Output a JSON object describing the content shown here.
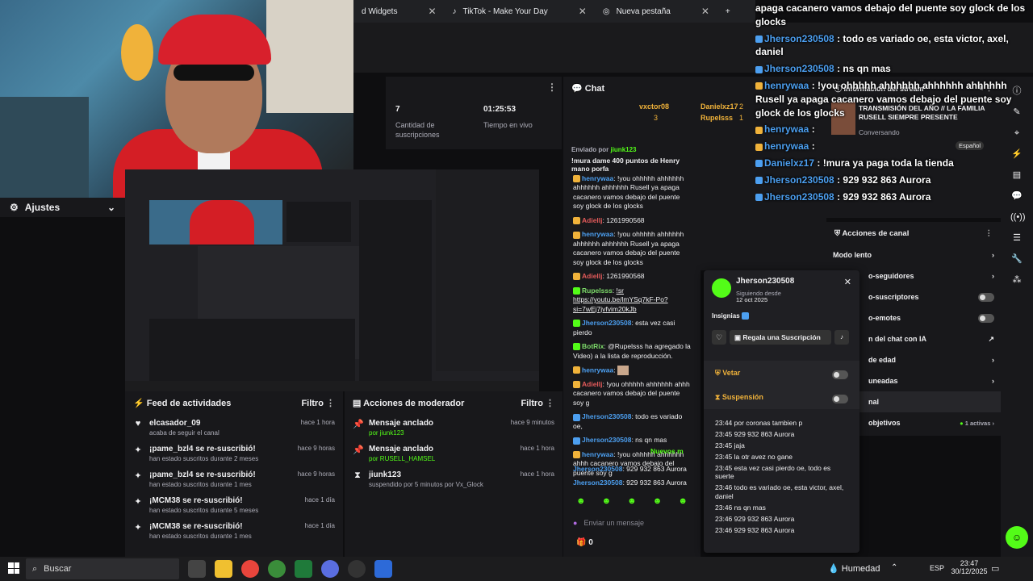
{
  "browser": {
    "tabs": [
      {
        "label": "d Widgets"
      },
      {
        "label": "TikTok - Make Your Day"
      },
      {
        "label": "Nueva pestaña"
      }
    ]
  },
  "settings": {
    "label": "Ajustes"
  },
  "stats": {
    "subs_value": "7",
    "subs_label": "Cantidad de suscripciones",
    "time_value": "01:25:53",
    "time_label": "Tiempo en vivo"
  },
  "feed": {
    "title": "Feed de actividades",
    "filter": "Filtro",
    "items": [
      {
        "title": "elcasador_09",
        "sub": "acaba de seguir el canal",
        "when": "hace 1 hora"
      },
      {
        "title": "¡pame_bzl4 se re-suscribió!",
        "sub": "han estado suscritos durante 2 meses",
        "when": "hace 9 horas"
      },
      {
        "title": "¡pame_bzl4 se re-suscribió!",
        "sub": "han estado suscritos durante 1 mes",
        "when": "hace 9 horas"
      },
      {
        "title": "¡MCM38 se re-suscribió!",
        "sub": "han estado suscritos durante 5 meses",
        "when": "hace 1 día"
      },
      {
        "title": "¡MCM38 se re-suscribió!",
        "sub": "han estado suscritos durante 1 mes",
        "when": "hace 1 día"
      }
    ]
  },
  "modactions": {
    "title": "Acciones de moderador",
    "filter": "Filtro",
    "items": [
      {
        "title": "Mensaje anclado",
        "sub": "por jiunk123",
        "when": "hace 9 minutos"
      },
      {
        "title": "Mensaje anclado",
        "sub": "por RUSELL_HAMSEL",
        "when": "hace 1 hora"
      },
      {
        "title": "jiunk123",
        "sub": "suspendido por 5 minutos por Vx_Glock",
        "when": "hace 1 hora"
      }
    ]
  },
  "chat": {
    "title": "Chat",
    "top_users": [
      "vxctor08",
      "Danielxz17",
      "Rupelsss"
    ],
    "top_counts": [
      "3",
      "2",
      "1"
    ],
    "pinned_by": "Enviado por",
    "pinned_user": "jiunk123",
    "pinned_msg": "!mura dame 400 puntos de Henry mano porfa",
    "lines": [
      {
        "user": "henrywaa",
        "color": "#4c9ff0",
        "text": "!you ohhhhh ahhhhhh ahhhhhh ahhhhhh Rusell ya apaga cacanero vamos debajo del puente soy glock de los glocks"
      },
      {
        "user": "Adiellj",
        "color": "#e25a5a",
        "text": "1261990568"
      },
      {
        "user": "henrywaa",
        "color": "#4c9ff0",
        "text": "!you ohhhhh ahhhhhh ahhhhhh ahhhhhh Rusell ya apaga cacanero vamos debajo del puente soy glock de los glocks"
      },
      {
        "user": "Adiellj",
        "color": "#e25a5a",
        "text": "1261990568"
      },
      {
        "user": "Rupelsss",
        "color": "#7ddb6a",
        "text": "!sr https://youtu.be/lmYSq7kF-Po?si=7wEj7jvfvim20kJb"
      },
      {
        "user": "Jherson230508",
        "color": "#4c9ff0",
        "text": "esta vez casi pierdo"
      },
      {
        "user": "BotRix",
        "color": "#7ddb6a",
        "text": "@Rupelsss ha agregado la Video) a la lista de reproducción."
      },
      {
        "user": "henrywaa",
        "color": "#4c9ff0",
        "text": ""
      },
      {
        "user": "Adiellj",
        "color": "#e25a5a",
        "text": "!you ohhhhh ahhhhhh ahhh cacanero vamos debajo del puente soy g"
      },
      {
        "user": "Jherson230508",
        "color": "#4c9ff0",
        "text": "todo es variado oe,"
      },
      {
        "user": "Jherson230508",
        "color": "#4c9ff0",
        "text": "ns qn mas"
      },
      {
        "user": "henrywaa",
        "color": "#4c9ff0",
        "text": "!you ohhhhh ahhhhhh ahhh cacanero vamos debajo del puente soy g"
      },
      {
        "user": "henrywaa",
        "color": "#4c9ff0",
        "text": ""
      },
      {
        "user": "henrywaa",
        "color": "#4c9ff0",
        "text": ""
      },
      {
        "user": "Danielxz17",
        "color": "#4c9ff0",
        "text": "!mura ya paga toda la"
      }
    ],
    "new_msgs": "Nuevos m",
    "after": [
      {
        "user": "Jherson230508",
        "color": "#4c9ff0",
        "text": "929 932 863 Aurora"
      },
      {
        "user": "Jherson230508",
        "color": "#4c9ff0",
        "text": "929 932 863 Aurora"
      }
    ],
    "input_placeholder": "Enviar un mensaje",
    "points": "0"
  },
  "usercard": {
    "name": "Jherson230508",
    "following_label": "Siguiendo desde",
    "following_date": "12 oct 2025",
    "badges_label": "Insignias",
    "gift_label": "Regala una Suscripción",
    "veto_label": "Vetar",
    "suspend_label": "Suspensión",
    "history": [
      "23:44 por coronas tambien p",
      "23:45 929 932 863 Aurora",
      "23:45 jaja",
      "23:45 la otr avez no gane",
      "23:45 esta vez casi pierdo oe, todo es suerte",
      "23:46 todo es variado oe, esta victor, axel, daniel",
      "23:46 ns qn mas",
      "23:46 929 932 863 Aurora",
      "23:46 929 932 863 Aurora"
    ]
  },
  "overlay": {
    "lines": [
      {
        "user": "",
        "text": "apaga cacanero vamos debajo del puente soy glock de los glocks"
      },
      {
        "user": "Jherson230508",
        "text": ": todo es variado oe, esta victor, axel, daniel"
      },
      {
        "user": "Jherson230508",
        "text": ": ns qn mas"
      },
      {
        "user": "henrywaa",
        "text": ": !you ohhhhh ahhhhhh ahhhhhh ahhhhhh Rusell ya apaga cacanero vamos debajo del puente soy glock de los glocks"
      },
      {
        "user": "henrywaa",
        "text": ":"
      },
      {
        "user": "henrywaa",
        "text": ":"
      },
      {
        "user": "Danielxz17",
        "text": ": !mura ya paga toda la tienda"
      },
      {
        "user": "Jherson230508",
        "text": ": 929 932 863 Aurora"
      },
      {
        "user": "Jherson230508",
        "text": ": 929 932 863 Aurora"
      }
    ]
  },
  "stream_info": {
    "title": "Información del stream",
    "stream_title": "TRANSMISIÓN DEL AÑO // LA FAMILIA RUSELL SIEMPRE PRESENTE",
    "category": "Conversando",
    "language": "Español"
  },
  "channel_actions": {
    "title": "Acciones de canal",
    "rows": [
      {
        "label": "Modo lento",
        "kind": "chevron"
      },
      {
        "label": "o-seguidores",
        "kind": "chevron"
      },
      {
        "label": "o-suscriptores",
        "kind": "toggle"
      },
      {
        "label": "o-emotes",
        "kind": "toggle"
      },
      {
        "label": "n del chat con IA",
        "kind": "external"
      },
      {
        "label": "de edad",
        "kind": "chevron"
      },
      {
        "label": "uneadas",
        "kind": "chevron"
      },
      {
        "label": "nal",
        "kind": "none"
      },
      {
        "label": "objetivos",
        "kind": "chevron"
      }
    ],
    "active_label": "1 activas"
  },
  "taskbar": {
    "search_label": "Buscar",
    "weather": "Humedad",
    "lang": "ESP",
    "time": "23:47",
    "date": "30/12/2025"
  },
  "colors": {
    "accent": "#53fc18",
    "bg": "#0e0e10",
    "panel": "#18181b"
  }
}
